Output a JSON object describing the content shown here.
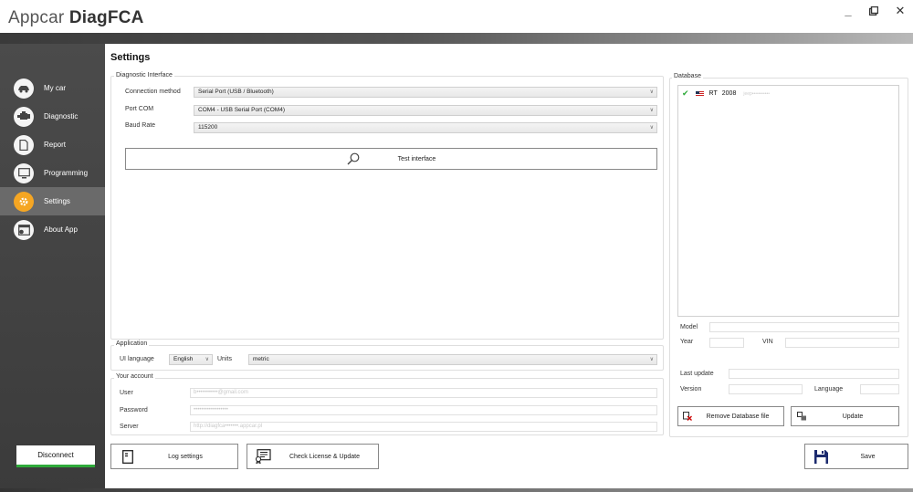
{
  "app": {
    "title_light": "Appcar",
    "title_bold": "DiagFCA"
  },
  "window": {
    "minimize": "_",
    "restore": "◱",
    "close": "✕"
  },
  "sidebar": {
    "items": [
      {
        "label": "My car",
        "icon": "car-icon"
      },
      {
        "label": "Diagnostic",
        "icon": "engine-icon"
      },
      {
        "label": "Report",
        "icon": "document-icon"
      },
      {
        "label": "Programming",
        "icon": "monitor-icon"
      },
      {
        "label": "Settings",
        "icon": "gear-icon",
        "active": true
      },
      {
        "label": "About App",
        "icon": "info-window-icon"
      }
    ],
    "disconnect_label": "Disconnect"
  },
  "main": {
    "heading": "Settings",
    "diagnostic_interface": {
      "title": "Diagnostic Interface",
      "connection_method_label": "Connection method",
      "connection_method_value": "Serial Port (USB / Bluetooth)",
      "port_label": "Port COM",
      "port_value": "COM4 - USB Serial Port (COM4)",
      "baud_label": "Baud Rate",
      "baud_value": "115200",
      "test_button": "Test interface"
    },
    "application": {
      "title": "Application",
      "ui_language_label": "UI language",
      "ui_language_value": "English",
      "units_label": "Units",
      "units_value": "metric"
    },
    "account": {
      "title": "Your account",
      "user_label": "User",
      "user_value": "b•••••••••••@gmail.com",
      "password_label": "Password",
      "password_value": "••••••••••••••••••",
      "server_label": "Server",
      "server_value": "http://diagfca•••••••.appcar.pl"
    },
    "log_settings_button": "Log settings",
    "license_button": "Check License & Update"
  },
  "database": {
    "title": "Database",
    "entries": [
      {
        "make": "RT",
        "year": "2008",
        "blurred": "jeep•••••••••••"
      }
    ],
    "model_label": "Model",
    "year_label": "Year",
    "vin_label": "VIN",
    "last_update_label": "Last update",
    "version_label": "Version",
    "language_label": "Language",
    "remove_button": "Remove Database file",
    "update_button": "Update"
  },
  "save_button": "Save",
  "colors": {
    "accent": "#f5a623",
    "success": "#2eaa3a",
    "sidebar": "#444444"
  }
}
